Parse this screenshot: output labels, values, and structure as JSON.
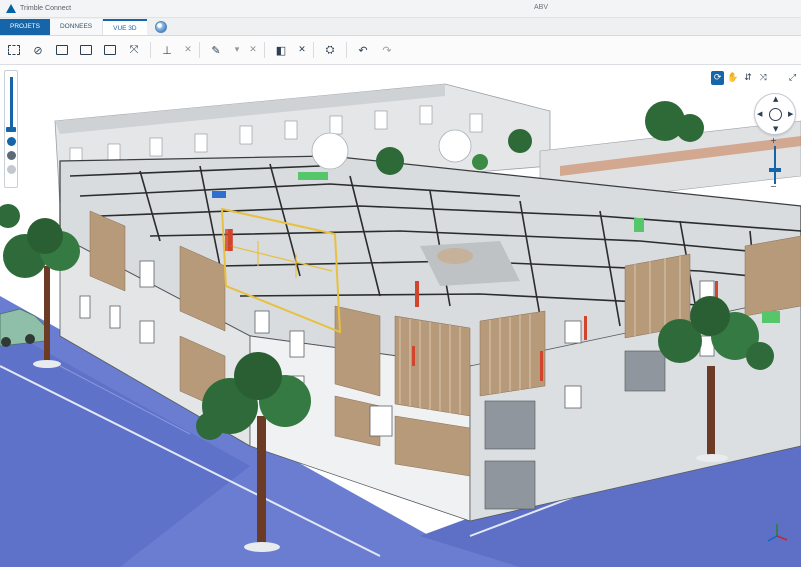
{
  "window": {
    "app_title": "Trimble Connect",
    "project_name": "ABV"
  },
  "tabs": [
    {
      "label": "PROJETS"
    },
    {
      "label": "DONNEES"
    },
    {
      "label": "VUE 3D"
    }
  ],
  "toolbar": {
    "icons": [
      "box-select-icon",
      "hide-icon",
      "model-icon",
      "section-icon",
      "section-box-icon",
      "fit-icon",
      "measure-icon",
      "close-icon",
      "markup-icon",
      "close-icon",
      "split-icon",
      "close-icon",
      "viewpoint-icon",
      "undo-icon",
      "redo-icon"
    ]
  },
  "viewer_controls": {
    "modes": [
      "rotate-icon",
      "pan-icon",
      "walk-icon",
      "fly-icon",
      "fullscreen-icon"
    ],
    "active_mode": "rotate-icon"
  },
  "colors": {
    "brand_blue": "#1565a8",
    "ground_blue": "#6a7dd0",
    "wall_gray": "#d4d7da",
    "tree_green": "#2f6b3a",
    "selection_yellow": "#e7c040"
  }
}
